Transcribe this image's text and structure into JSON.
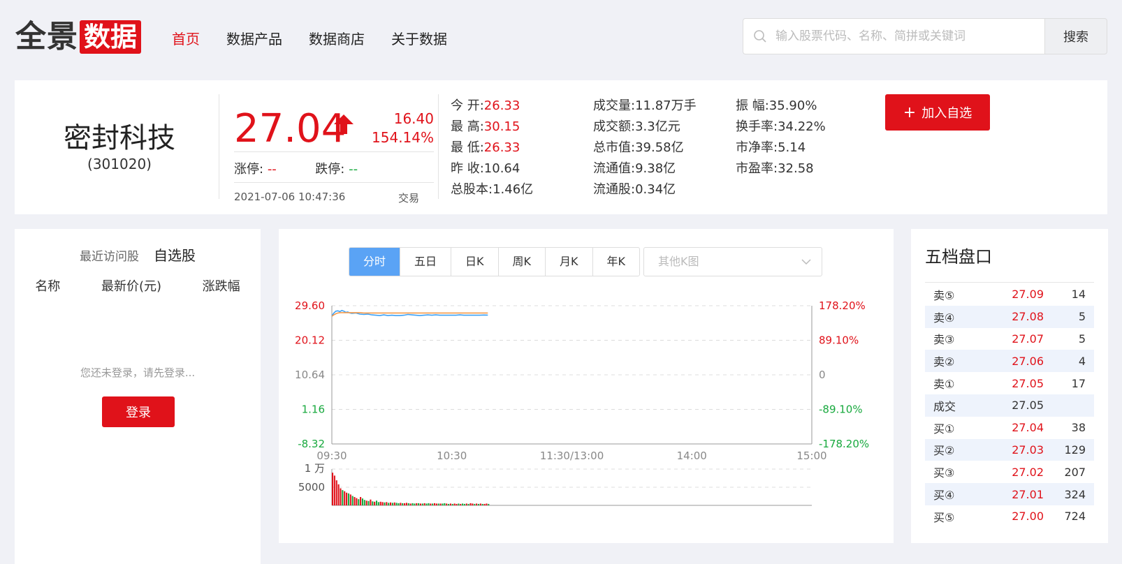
{
  "header": {
    "logo_left": "全景",
    "logo_right": "数据",
    "nav": [
      "首页",
      "数据产品",
      "数据商店",
      "关于数据"
    ],
    "search_placeholder": "输入股票代码、名称、简拼或关键词",
    "search_button": "搜索"
  },
  "quote": {
    "name": "密封科技",
    "code": "(301020)",
    "price": "27.04",
    "change": "16.40",
    "change_pct": "154.14%",
    "limit_up_label": "涨停:",
    "limit_up_value": "--",
    "limit_down_label": "跌停:",
    "limit_down_value": "--",
    "datetime": "2021-07-06 10:47:36",
    "status": "交易",
    "stats": [
      [
        {
          "label": "今 开:",
          "value": "26.33",
          "red": true
        },
        {
          "label": "最 高:",
          "value": "30.15",
          "red": true
        },
        {
          "label": "最 低:",
          "value": "26.33",
          "red": true
        },
        {
          "label": "昨 收:",
          "value": "10.64",
          "red": false
        },
        {
          "label": "总股本:",
          "value": "1.46亿",
          "red": false
        }
      ],
      [
        {
          "label": "成交量:",
          "value": "11.87万手",
          "red": false
        },
        {
          "label": "成交额:",
          "value": "3.3亿元",
          "red": false
        },
        {
          "label": "总市值:",
          "value": "39.58亿",
          "red": false
        },
        {
          "label": "流通值:",
          "value": "9.38亿",
          "red": false
        },
        {
          "label": "流通股:",
          "value": "0.34亿",
          "red": false
        }
      ],
      [
        {
          "label": "振 幅:",
          "value": "35.90%",
          "red": false
        },
        {
          "label": "换手率:",
          "value": "34.22%",
          "red": false
        },
        {
          "label": "市净率:",
          "value": "5.14",
          "red": false
        },
        {
          "label": "市盈率:",
          "value": "32.58",
          "red": false
        }
      ]
    ],
    "add_button": "加入自选"
  },
  "left_panel": {
    "tab_recent": "最近访问股",
    "tab_watch": "自选股",
    "col_name": "名称",
    "col_price": "最新价(元)",
    "col_change": "涨跌幅",
    "login_tip": "您还未登录，请先登录...",
    "login_button": "登录"
  },
  "chart_panel": {
    "tabs": [
      "分时",
      "五日",
      "日K",
      "周K",
      "月K",
      "年K"
    ],
    "active_tab": "分时",
    "select_placeholder": "其他K图"
  },
  "chart_data": {
    "type": "line",
    "y_left_ticks": [
      "29.60",
      "20.12",
      "10.64",
      "1.16",
      "-8.32"
    ],
    "y_right_ticks": [
      "178.20%",
      "89.10%",
      "0",
      "-89.10%",
      "-178.20%"
    ],
    "x_ticks": [
      "09:30",
      "10:30",
      "11:30/13:00",
      "14:00",
      "15:00"
    ],
    "ylim": [
      -8.32,
      29.6
    ],
    "prev_close": 10.64,
    "minutes": [
      0,
      1,
      2,
      3,
      4,
      5,
      6,
      7,
      8,
      9,
      10,
      12,
      14,
      16,
      18,
      20,
      22,
      24,
      26,
      28,
      30,
      32,
      34,
      36,
      38,
      40,
      42,
      44,
      46,
      48,
      50,
      52,
      54,
      56,
      58,
      60,
      62,
      64,
      66,
      68,
      70,
      72,
      74,
      76,
      78
    ],
    "series": [
      {
        "values": [
          26.8,
          27.6,
          28.1,
          28.2,
          28.0,
          28.3,
          28.1,
          27.8,
          27.9,
          27.6,
          27.5,
          27.6,
          27.3,
          27.2,
          27.3,
          27.1,
          27.0,
          26.9,
          27.1,
          26.9,
          27.0,
          26.9,
          26.9,
          27.0,
          27.2,
          27.1,
          27.0,
          26.9,
          27.0,
          27.1,
          27.0,
          27.1,
          27.0,
          27.0,
          27.0,
          27.0,
          27.0,
          27.1,
          27.0,
          27.0,
          27.0,
          27.0,
          27.0,
          27.05,
          27.04
        ]
      },
      {
        "values": [
          26.7,
          27.1,
          27.4,
          27.6,
          27.7,
          27.7,
          27.7,
          27.7,
          27.7,
          27.7,
          27.7,
          27.7,
          27.7,
          27.6,
          27.6,
          27.6,
          27.6,
          27.6,
          27.6,
          27.6,
          27.6,
          27.6,
          27.6,
          27.6,
          27.6,
          27.6,
          27.6,
          27.6,
          27.6,
          27.6,
          27.6,
          27.6,
          27.6,
          27.6,
          27.6,
          27.6,
          27.6,
          27.6,
          27.6,
          27.6,
          27.6,
          27.6,
          27.6,
          27.6,
          27.6
        ]
      }
    ],
    "volume_ticks": [
      "1 万",
      "5000"
    ],
    "volume_max": 10000,
    "volume": [
      9000,
      8200,
      6900,
      5800,
      4700,
      4200,
      3900,
      3500,
      3300,
      3000,
      2600,
      2300,
      2000,
      1700,
      2300,
      1900,
      1500,
      1300,
      1200,
      1600,
      1100,
      1000,
      1300,
      900,
      1000,
      900,
      800,
      900,
      700,
      800,
      700,
      800,
      700,
      600,
      700,
      600,
      600,
      700,
      600,
      500,
      600,
      500,
      600,
      600,
      500,
      500,
      600,
      500,
      600,
      500,
      500,
      600,
      500,
      500,
      500,
      500,
      600,
      500,
      400,
      500,
      400,
      500,
      400,
      500,
      400,
      500,
      400,
      500,
      400,
      600,
      500,
      400,
      500,
      400,
      500,
      400,
      400,
      500,
      400
    ],
    "volume_up": [
      1,
      1,
      1,
      1,
      1,
      0,
      1,
      1,
      0,
      1,
      0,
      1,
      1,
      0,
      1,
      0,
      0,
      1,
      0,
      1,
      0,
      1,
      0,
      0,
      1,
      1,
      0,
      1,
      0,
      1,
      0,
      1,
      0,
      0,
      1,
      0,
      1,
      1,
      0,
      1,
      0,
      0,
      1,
      0,
      1,
      0,
      1,
      0,
      0,
      1,
      0,
      1,
      1,
      0,
      1,
      0,
      0,
      1,
      0,
      1,
      0,
      1,
      1,
      0,
      1,
      0,
      0,
      1,
      0,
      1,
      1,
      0,
      1,
      0,
      1,
      0,
      1,
      1
    ]
  },
  "order_book": {
    "title": "五档盘口",
    "rows": [
      {
        "label": "卖⑤",
        "price": "27.09",
        "vol": "14",
        "red": true
      },
      {
        "label": "卖④",
        "price": "27.08",
        "vol": "5",
        "red": true
      },
      {
        "label": "卖③",
        "price": "27.07",
        "vol": "5",
        "red": true
      },
      {
        "label": "卖②",
        "price": "27.06",
        "vol": "4",
        "red": true
      },
      {
        "label": "卖①",
        "price": "27.05",
        "vol": "17",
        "red": true
      },
      {
        "label": "成交",
        "price": "27.05",
        "vol": "",
        "red": false
      },
      {
        "label": "买①",
        "price": "27.04",
        "vol": "38",
        "red": true
      },
      {
        "label": "买②",
        "price": "27.03",
        "vol": "129",
        "red": true
      },
      {
        "label": "买③",
        "price": "27.02",
        "vol": "207",
        "red": true
      },
      {
        "label": "买④",
        "price": "27.01",
        "vol": "324",
        "red": true
      },
      {
        "label": "买⑤",
        "price": "27.00",
        "vol": "724",
        "red": true
      }
    ]
  },
  "colors": {
    "accent_red": "#e0121a",
    "green": "#18a93e",
    "price_line": "#3da1f5",
    "avg_line": "#f59a4a",
    "active_tab": "#5aa3f5"
  }
}
